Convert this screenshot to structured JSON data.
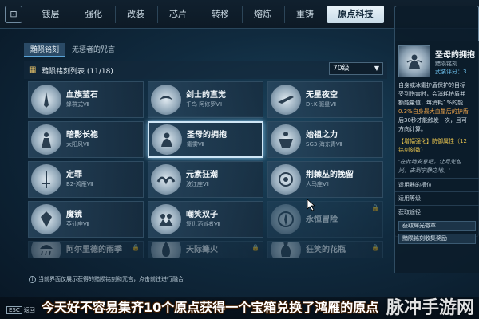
{
  "nav": {
    "tabs": [
      {
        "label": "镀层"
      },
      {
        "label": "强化"
      },
      {
        "label": "改装"
      },
      {
        "label": "芯片"
      },
      {
        "label": "转移"
      },
      {
        "label": "熔炼"
      },
      {
        "label": "重铸"
      },
      {
        "label": "原点科技"
      }
    ],
    "active_index": 7
  },
  "left": {
    "subtabs": [
      "黯陨铭刻",
      "无惩者的咒言"
    ],
    "list_title": "黯陨铭刻列表 (11/18)",
    "level_select": "70级",
    "cards": [
      {
        "name": "血族莹石",
        "sub": "蜂群式Ⅶ",
        "icon": "fang-icon",
        "state": "normal"
      },
      {
        "name": "剑士的直觉",
        "sub": "千鸟·阿修罗Ⅶ",
        "icon": "crescent-icon",
        "state": "normal"
      },
      {
        "name": "无星夜空",
        "sub": "Dr.K-驱星Ⅶ",
        "icon": "jet-icon",
        "state": "normal"
      },
      {
        "name": "暗影长袍",
        "sub": "太阳风Ⅶ",
        "icon": "cloak-icon",
        "state": "normal"
      },
      {
        "name": "圣母的拥抱",
        "sub": "霜雾Ⅶ",
        "icon": "embrace-icon",
        "state": "selected"
      },
      {
        "name": "始祖之力",
        "sub": "SG3-海东青Ⅶ",
        "icon": "titan-icon",
        "state": "normal"
      },
      {
        "name": "定罪",
        "sub": "B2-鸿雁Ⅶ",
        "icon": "sword-icon",
        "state": "normal"
      },
      {
        "name": "元素狂潮",
        "sub": "波江座Ⅶ",
        "icon": "wave-icon",
        "state": "normal"
      },
      {
        "name": "荆棘丛的挽留",
        "sub": "人马座Ⅶ",
        "icon": "thorn-icon",
        "state": "normal"
      },
      {
        "name": "魔镜",
        "sub": "英仙座Ⅶ",
        "icon": "mirror-icon",
        "state": "normal"
      },
      {
        "name": "嘲笑双子",
        "sub": "复仇洒派者Ⅶ",
        "icon": "twins-icon",
        "state": "normal"
      },
      {
        "name": "永恒冒险",
        "sub": "",
        "icon": "compass-icon",
        "state": "locked"
      },
      {
        "name": "阿尔里德的雨季",
        "sub": "",
        "icon": "rain-icon",
        "state": "locked"
      },
      {
        "name": "天际篝火",
        "sub": "",
        "icon": "fire-icon",
        "state": "locked"
      },
      {
        "name": "狂笑的花瓶",
        "sub": "",
        "icon": "vase-icon",
        "state": "locked"
      }
    ],
    "hint": "当前界面仅展示获得的黯陨铭刻和咒言，点击前往进行融合"
  },
  "detail": {
    "title": "圣母的拥抱",
    "category": "黯陨铭刻",
    "status": "武装评分：3",
    "desc_lines": [
      "自身或冰霜护盾保护的目标",
      "受到伤害时，会消耗护盾并",
      "额能量值，每消耗1%的能",
      "0.3%自身最大血量后的护盾",
      "后30秒才能触发一次，且可",
      "方向计算。"
    ],
    "effect": "【增幅强化】防御属性（12",
    "effect2": "铭刻刻数）",
    "quote": [
      "'在此地安息吧，让月光包",
      "光，去到宁静之地。'"
    ],
    "rows": [
      "适用器的槽位",
      "适用等级"
    ],
    "get_label": "获取途径",
    "buttons": [
      "获取辉光徽章",
      "黯陨铭刻收集奖励"
    ]
  },
  "bottom": {
    "esc": "ESC",
    "esc_label": "返回",
    "caption": "今天好不容易集齐10个原点获得一个宝箱兑换了鸿雁的原点",
    "watermark": "脉冲手游网"
  }
}
